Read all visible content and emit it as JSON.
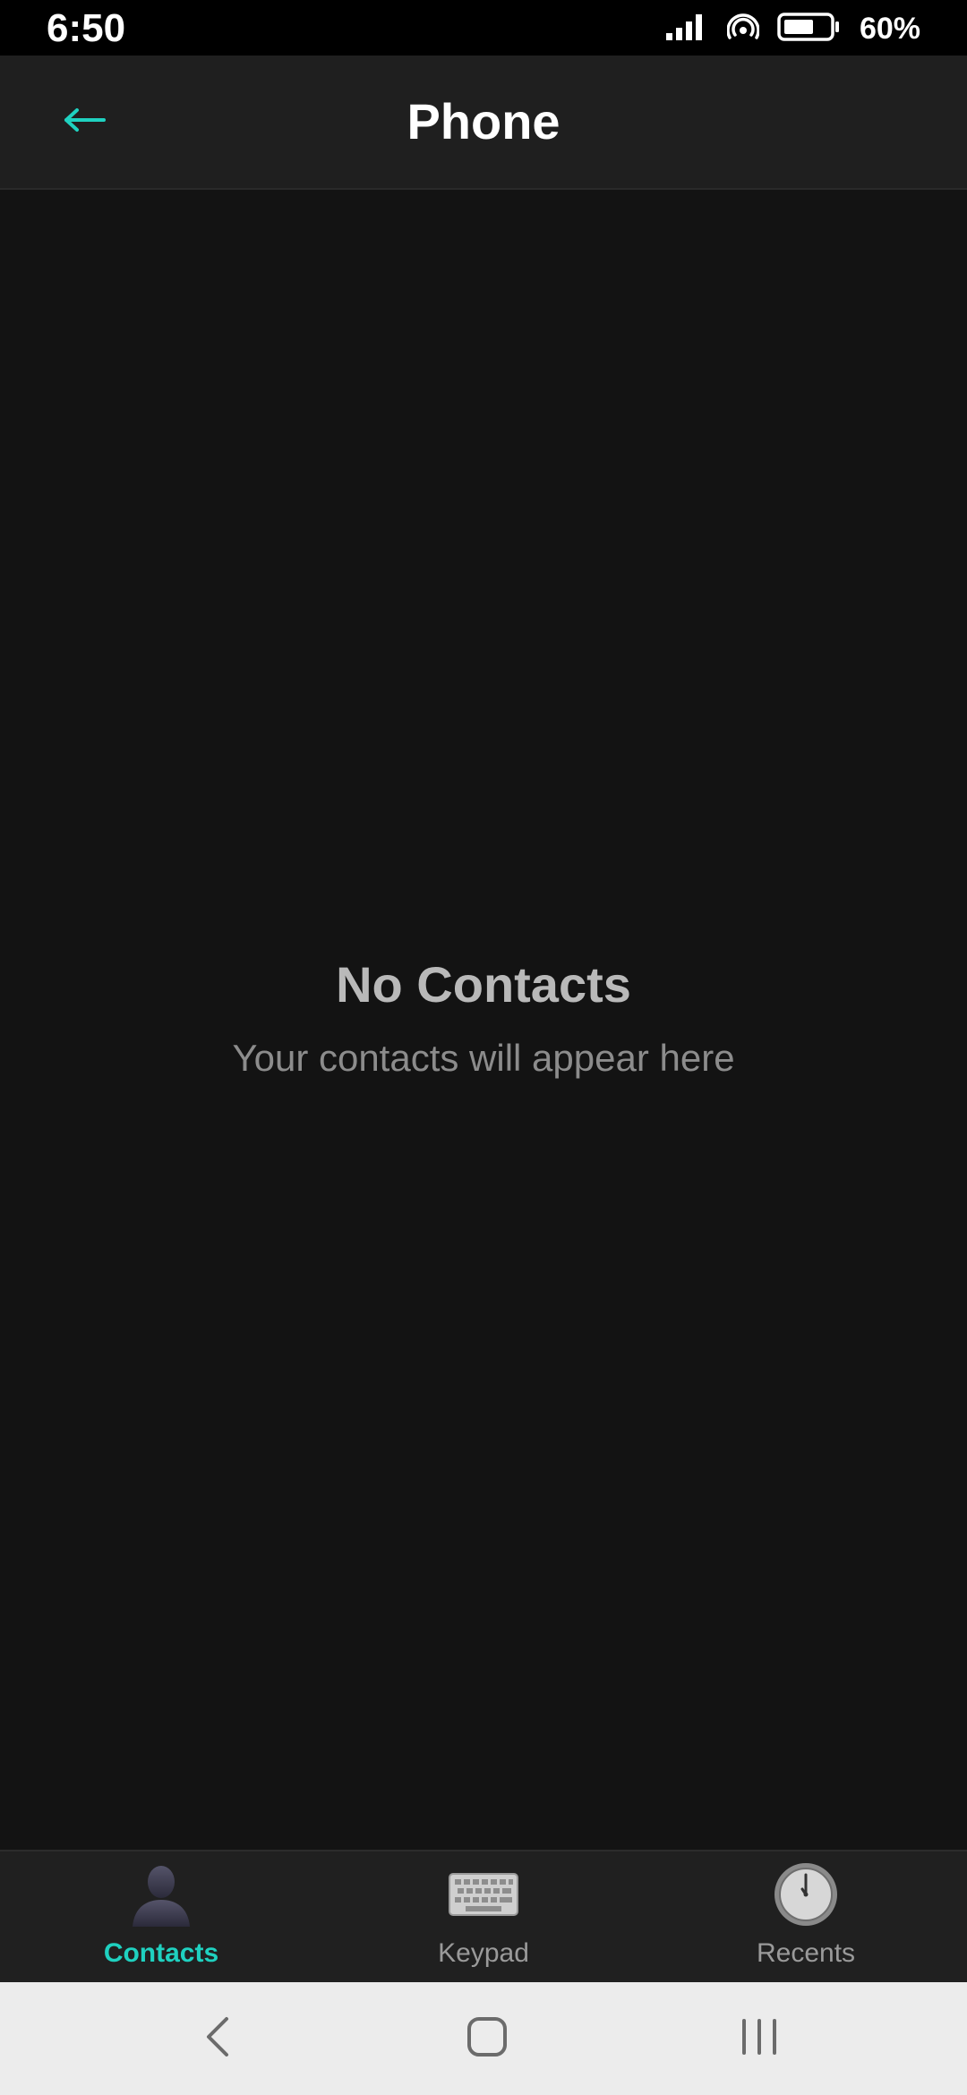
{
  "status_bar": {
    "time": "6:50",
    "battery_percent": "60%",
    "icons": [
      "signal-icon",
      "hotspot-icon",
      "battery-icon"
    ]
  },
  "header": {
    "title": "Phone",
    "back_icon": "back-arrow-icon",
    "accent_color": "#1fd1c0"
  },
  "empty_state": {
    "title": "No Contacts",
    "subtitle": "Your contacts will appear here"
  },
  "tabs": [
    {
      "label": "Contacts",
      "icon": "person-silhouette-icon",
      "active": true
    },
    {
      "label": "Keypad",
      "icon": "keyboard-icon",
      "active": false
    },
    {
      "label": "Recents",
      "icon": "clock-icon",
      "active": false
    }
  ],
  "system_nav": [
    "back-icon",
    "home-icon",
    "recents-icon"
  ]
}
